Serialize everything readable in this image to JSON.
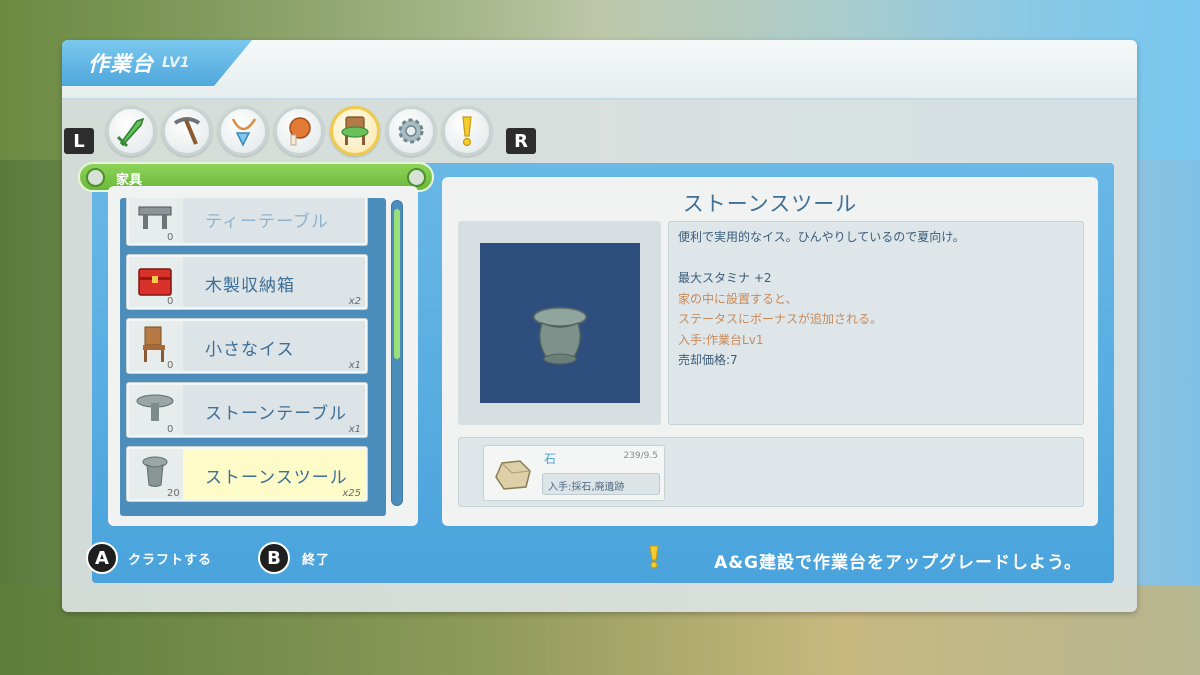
{
  "window": {
    "title": "作業台",
    "level": "LV1"
  },
  "tabs": {
    "left_button": "L",
    "right_button": "R",
    "icons": [
      "sword-icon",
      "pickaxe-icon",
      "necklace-icon",
      "meat-icon",
      "chair-icon",
      "gear-icon",
      "exclamation-icon"
    ],
    "active_index": 4
  },
  "category": {
    "label": "家具"
  },
  "list": {
    "items": [
      {
        "name": "ティーテーブル",
        "stock": "0",
        "qty": ""
      },
      {
        "name": "木製収納箱",
        "stock": "0",
        "qty": "x2"
      },
      {
        "name": "小さなイス",
        "stock": "0",
        "qty": "x1"
      },
      {
        "name": "ストーンテーブル",
        "stock": "0",
        "qty": "x1"
      },
      {
        "name": "ストーンスツール",
        "stock": "20",
        "qty": "x25"
      }
    ],
    "selected_index": 4
  },
  "detail": {
    "title": "ストーンスツール",
    "description": [
      "便利で実用的なイス。ひんやりしているので夏向け。",
      "",
      "最大スタミナ +2",
      "家の中に設置すると、",
      "ステータスにボーナスが追加される。",
      "入手:作業台Lv1",
      "売却価格:7"
    ],
    "material": {
      "name": "石",
      "count": "239/9.5",
      "source": "入手:採石,廃遺跡"
    }
  },
  "footer": {
    "a_button": "A",
    "a_label": "クラフトする",
    "b_button": "B",
    "b_label": "終了",
    "tip": "A&G建設で作業台をアップグレードしよう。"
  },
  "colors": {
    "accent_blue": "#4fa7dc",
    "category_green": "#6ab83b",
    "selected_yellow": "#fdfbc7",
    "effect_orange": "#c88a5a"
  }
}
